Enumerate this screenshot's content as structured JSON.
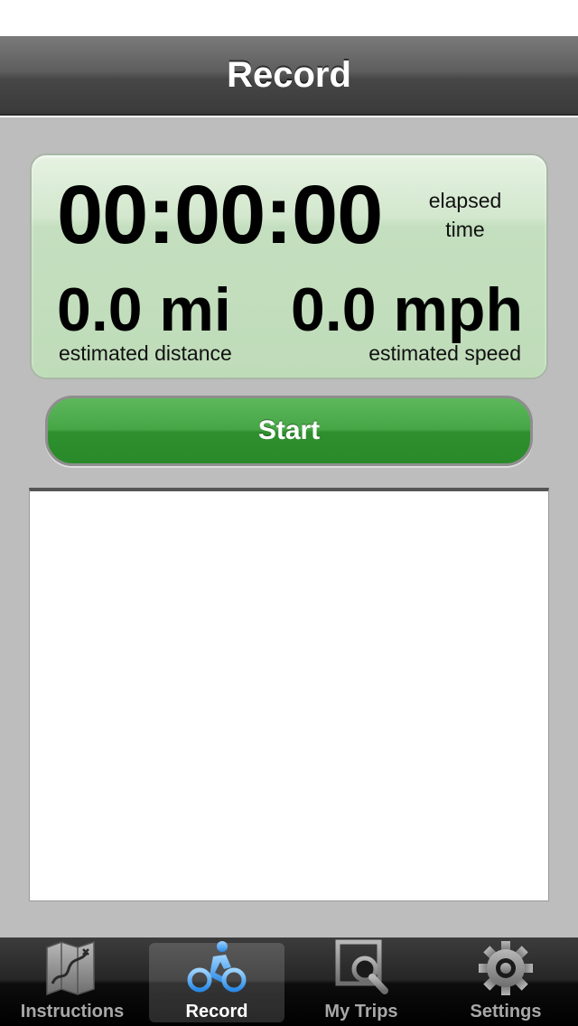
{
  "header": {
    "title": "Record"
  },
  "stats": {
    "elapsed_time": "00:00:00",
    "elapsed_label_line1": "elapsed",
    "elapsed_label_line2": "time",
    "distance": "0.0 mi",
    "distance_label": "estimated distance",
    "speed": "0.0 mph",
    "speed_label": "estimated speed"
  },
  "start_button": {
    "label": "Start"
  },
  "tabs": [
    {
      "label": "Instructions",
      "icon": "map-icon",
      "active": false
    },
    {
      "label": "Record",
      "icon": "bike-icon",
      "active": true
    },
    {
      "label": "My Trips",
      "icon": "search-trips-icon",
      "active": false
    },
    {
      "label": "Settings",
      "icon": "gear-icon",
      "active": false
    }
  ],
  "colors": {
    "accent_green": "#2e8f2e",
    "panel_green": "#c4dfbf",
    "active_tab_icon": "#4aa8f0"
  }
}
